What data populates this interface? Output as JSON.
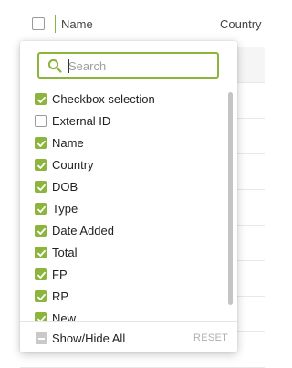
{
  "grid": {
    "header": {
      "name": "Name",
      "country": "Country"
    }
  },
  "colors": {
    "accent": "#8bb53c"
  },
  "panel": {
    "search": {
      "placeholder": "Search",
      "value": ""
    },
    "columns": [
      {
        "label": "Checkbox selection",
        "checked": true
      },
      {
        "label": "External ID",
        "checked": false
      },
      {
        "label": "Name",
        "checked": true
      },
      {
        "label": "Country",
        "checked": true
      },
      {
        "label": "DOB",
        "checked": true
      },
      {
        "label": "Type",
        "checked": true
      },
      {
        "label": "Date Added",
        "checked": true
      },
      {
        "label": "Total",
        "checked": true
      },
      {
        "label": "FP",
        "checked": true
      },
      {
        "label": "RP",
        "checked": true
      },
      {
        "label": "New",
        "checked": true
      }
    ],
    "footer": {
      "show_hide_all": "Show/Hide All",
      "reset": "RESET"
    }
  }
}
